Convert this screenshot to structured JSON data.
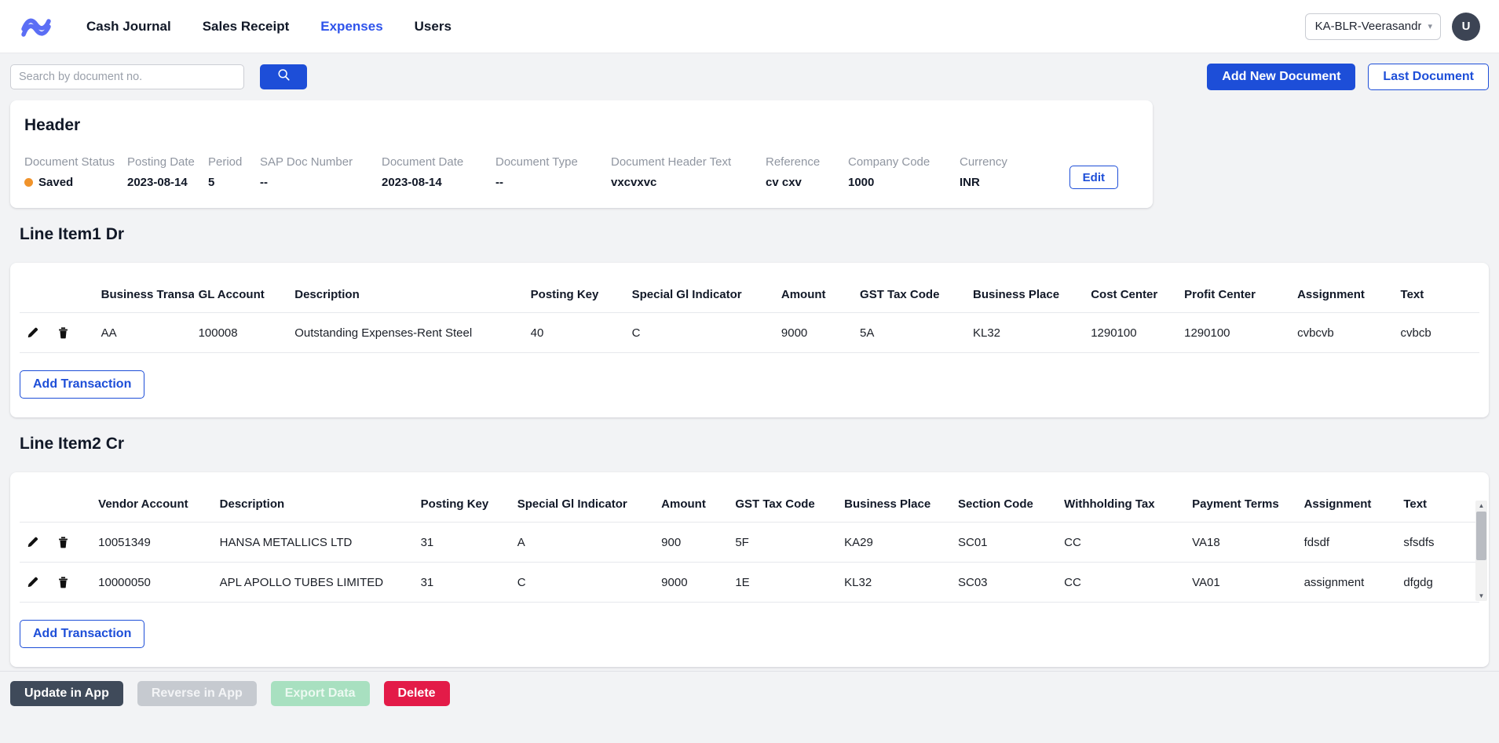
{
  "navbar": {
    "logo_icon": "wave-logo-icon",
    "links": [
      {
        "label": "Cash Journal",
        "active": false
      },
      {
        "label": "Sales Receipt",
        "active": false
      },
      {
        "label": "Expenses",
        "active": true
      },
      {
        "label": "Users",
        "active": false
      }
    ],
    "org_select": {
      "value": "KA-BLR-Veerasandr",
      "caret_icon": "chevron-down-icon"
    },
    "avatar": {
      "initial": "U"
    }
  },
  "toolbar": {
    "search_placeholder": "Search by document no.",
    "search_value": "",
    "search_button_icon": "search-icon",
    "add_new_document_label": "Add New Document",
    "last_document_label": "Last Document"
  },
  "header_card": {
    "title": "Header",
    "edit_label": "Edit",
    "status_color": "#f0932b",
    "fields": [
      {
        "label": "Document Status",
        "value": "Saved",
        "has_dot": true
      },
      {
        "label": "Posting Date",
        "value": "2023-08-14",
        "has_dot": false
      },
      {
        "label": "Period",
        "value": "5",
        "has_dot": false
      },
      {
        "label": "SAP Doc Number",
        "value": "--",
        "has_dot": false
      },
      {
        "label": "Document Date",
        "value": "2023-08-14",
        "has_dot": false
      },
      {
        "label": "Document Type",
        "value": "--",
        "has_dot": false
      },
      {
        "label": "Document Header Text",
        "value": "vxcvxvc",
        "has_dot": false
      },
      {
        "label": "Reference",
        "value": "cv cxv",
        "has_dot": false
      },
      {
        "label": "Company Code",
        "value": "1000",
        "has_dot": false
      },
      {
        "label": "Currency",
        "value": "INR",
        "has_dot": false
      }
    ]
  },
  "line_item_1": {
    "title": "Line Item1 Dr",
    "add_transaction_label": "Add Transaction",
    "row_edit_icon": "pencil-icon",
    "row_delete_icon": "trash-icon",
    "columns": [
      "",
      "Business Transaction",
      "GL Account",
      "Description",
      "Posting Key",
      "Special Gl Indicator",
      "Amount",
      "GST Tax Code",
      "Business Place",
      "Cost Center",
      "Profit Center",
      "Assignment",
      "Text"
    ],
    "rows": [
      {
        "business_transaction": "AA",
        "gl_account": "100008",
        "description": "Outstanding Expenses-Rent Steel",
        "posting_key": "40",
        "special_gl_indicator": "C",
        "amount": "9000",
        "gst_tax_code": "5A",
        "business_place": "KL32",
        "cost_center": "1290100",
        "profit_center": "1290100",
        "assignment": "cvbcvb",
        "text": "cvbcb"
      }
    ]
  },
  "line_item_2": {
    "title": "Line Item2 Cr",
    "add_transaction_label": "Add Transaction",
    "row_edit_icon": "pencil-icon",
    "row_delete_icon": "trash-icon",
    "scrollbar": {
      "up_icon": "triangle-up-icon",
      "down_icon": "triangle-down-icon"
    },
    "columns": [
      "",
      "Vendor Account",
      "Description",
      "Posting Key",
      "Special Gl Indicator",
      "Amount",
      "GST Tax Code",
      "Business Place",
      "Section Code",
      "Withholding Tax",
      "Payment Terms",
      "Assignment",
      "Text"
    ],
    "rows": [
      {
        "vendor_account": "10051349",
        "description": "HANSA METALLICS LTD",
        "posting_key": "31",
        "special_gl_indicator": "A",
        "amount": "900",
        "gst_tax_code": "5F",
        "business_place": "KA29",
        "section_code": "SC01",
        "withholding_tax": "CC",
        "payment_terms": "VA18",
        "assignment": "fdsdf",
        "text": "sfsdfs"
      },
      {
        "vendor_account": "10000050",
        "description": "APL APOLLO TUBES LIMITED",
        "posting_key": "31",
        "special_gl_indicator": "C",
        "amount": "9000",
        "gst_tax_code": "1E",
        "business_place": "KL32",
        "section_code": "SC03",
        "withholding_tax": "CC",
        "payment_terms": "VA01",
        "assignment": "assignment",
        "text": "dfgdg"
      }
    ]
  },
  "footer": {
    "update_in_app_label": "Update in App",
    "reverse_in_app_label": "Reverse in App",
    "export_data_label": "Export Data",
    "delete_label": "Delete"
  }
}
